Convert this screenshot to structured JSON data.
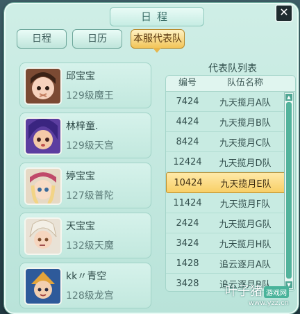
{
  "window": {
    "title": "日程",
    "close_glyph": "✕"
  },
  "tabs": [
    {
      "label": "日程"
    },
    {
      "label": "日历"
    },
    {
      "label": "本服代表队"
    }
  ],
  "members": [
    {
      "name": "邱宝宝",
      "level": "129级魔王"
    },
    {
      "name": "林梓童.",
      "level": "129级天宫"
    },
    {
      "name": "婷宝宝",
      "level": "127级普陀"
    },
    {
      "name": "天宝宝",
      "level": "132级天魔"
    },
    {
      "name": "kk〃青空",
      "level": "128级龙宫"
    }
  ],
  "team_list": {
    "title": "代表队列表",
    "col_num": "编号",
    "col_name": "队伍名称",
    "rows": [
      {
        "num": "7424",
        "name": "九天揽月A队"
      },
      {
        "num": "4424",
        "name": "九天揽月B队"
      },
      {
        "num": "8424",
        "name": "九天揽月C队"
      },
      {
        "num": "12424",
        "name": "九天揽月D队"
      },
      {
        "num": "10424",
        "name": "九天揽月E队"
      },
      {
        "num": "11424",
        "name": "九天揽月F队"
      },
      {
        "num": "2424",
        "name": "九天揽月G队"
      },
      {
        "num": "3424",
        "name": "九天揽月H队"
      },
      {
        "num": "1428",
        "name": "追云逐月A队"
      },
      {
        "num": "3428",
        "name": "追云逐月B队"
      }
    ],
    "scroll_up": "▲",
    "scroll_down": "▼"
  },
  "watermark": {
    "main": "叶子猪",
    "tag": "游戏网",
    "url": "www.yzz.cn"
  },
  "colors": {
    "accent": "#f2c458",
    "panel": "#c2e8de"
  }
}
